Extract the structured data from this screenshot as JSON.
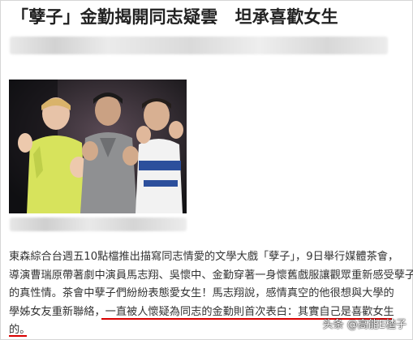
{
  "article": {
    "headline": "「孽子」金勤揭開同志疑雲　坦承喜歡女生",
    "body_lines": [
      "東森綜合台週五10點檔推出描寫同志情愛的文學大戲「孽子」，9日舉行媒體茶會，",
      "導演曹瑞原帶著劇中演員馬志翔、吳懷中、金勤穿著一身懷舊戲服讓觀眾重新感受孽子",
      "的真性情。茶會中孽子們紛紛表態愛女生！馬志翔說，感情真空的他很想與大學的",
      "學姊女友重新聯絡，一直被人懷疑為同志的金勤則首次表白：其實自己是喜歡女生",
      "的。"
    ]
  },
  "watermark": {
    "text": "头条 @高能E楂子"
  },
  "colors": {
    "underline": "#d90000",
    "headline": "#222222",
    "body": "#333333"
  }
}
